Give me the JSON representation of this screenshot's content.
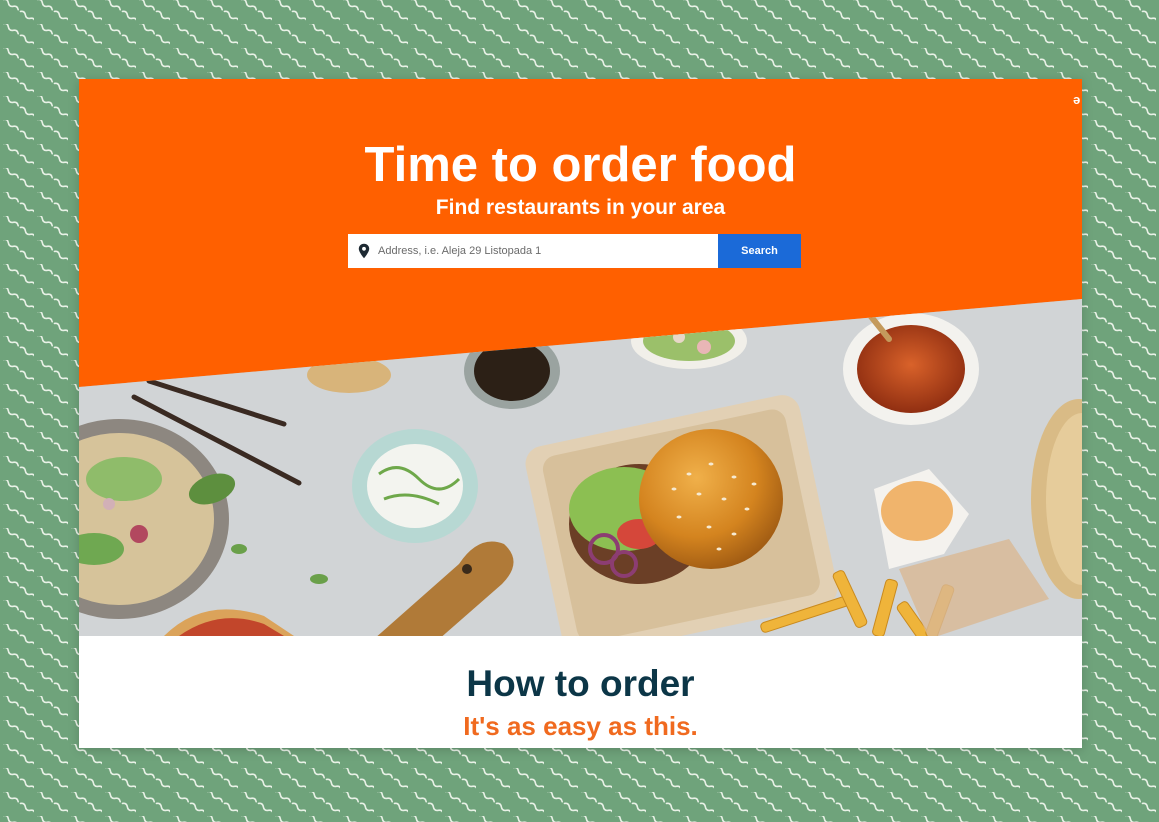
{
  "hero": {
    "title": "Time to order food",
    "subtitle": "Find restaurants in your area"
  },
  "search": {
    "placeholder": "Address, i.e. Aleja 29 Listopada 1",
    "button_label": "Search",
    "icon": "location-pin-icon"
  },
  "how_to": {
    "title": "How to order",
    "subtitle": "It's as easy as this."
  },
  "colors": {
    "brand_orange": "#ff6000",
    "search_button": "#1b6ad8",
    "heading_dark": "#0c3647",
    "accent_orange": "#f06a1f",
    "backdrop_green": "#6fa37b"
  }
}
